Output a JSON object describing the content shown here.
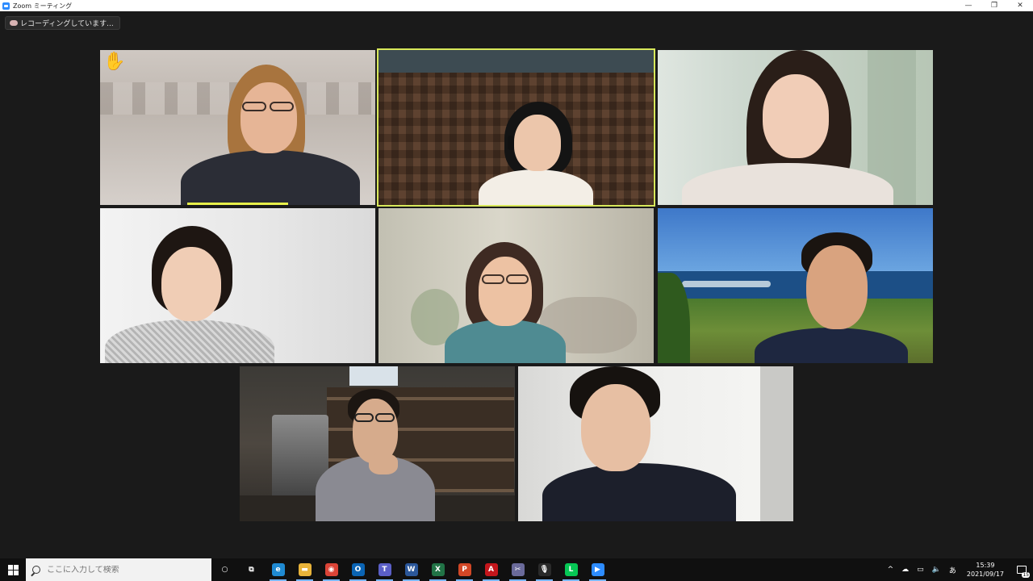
{
  "window": {
    "title": "Zoom ミーティング",
    "minimize_glyph": "—",
    "restore_glyph": "❐",
    "close_glyph": "✕"
  },
  "recording": {
    "label": "レコーディングしています..."
  },
  "raised_hand_glyph": "✋",
  "taskbar": {
    "search_placeholder": "ここに入力して検索",
    "apps": [
      {
        "name": "cortana-icon",
        "glyph": "○",
        "color": "#101010"
      },
      {
        "name": "task-view-icon",
        "glyph": "⧉",
        "color": "#101010"
      },
      {
        "name": "edge-icon",
        "glyph": "e",
        "color": "#1f8ad2"
      },
      {
        "name": "file-explorer-icon",
        "glyph": "▬",
        "color": "#e8b33a"
      },
      {
        "name": "chrome-icon",
        "glyph": "◉",
        "color": "#db4437"
      },
      {
        "name": "outlook-icon",
        "glyph": "O",
        "color": "#0a64b4"
      },
      {
        "name": "teams-icon",
        "glyph": "T",
        "color": "#5b5fc7"
      },
      {
        "name": "word-icon",
        "glyph": "W",
        "color": "#2b579a"
      },
      {
        "name": "excel-icon",
        "glyph": "X",
        "color": "#217346"
      },
      {
        "name": "powerpoint-icon",
        "glyph": "P",
        "color": "#d24726"
      },
      {
        "name": "acrobat-icon",
        "glyph": "A",
        "color": "#c4161c"
      },
      {
        "name": "snipping-tool-icon",
        "glyph": "✂",
        "color": "#6a6a9a"
      },
      {
        "name": "microphone-app-icon",
        "glyph": "🎙",
        "color": "#2a2a2a"
      },
      {
        "name": "line-icon",
        "glyph": "L",
        "color": "#06c755"
      },
      {
        "name": "zoom-icon",
        "glyph": "▶",
        "color": "#2d8cff"
      }
    ],
    "tray": {
      "chevron": "^",
      "cloud": "☁",
      "network": "▭",
      "volume": "🔈",
      "ime": "あ"
    },
    "clock_time": "15:39",
    "clock_date": "2021/09/17",
    "notification_count": "15"
  }
}
